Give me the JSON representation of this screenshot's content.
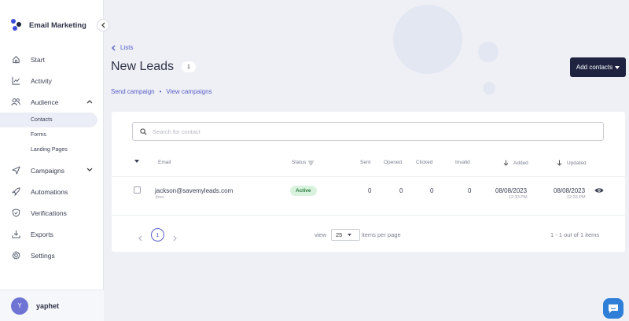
{
  "app": {
    "name": "Email Marketing"
  },
  "sidebar": {
    "items": [
      {
        "label": "Start",
        "icon": "home-icon"
      },
      {
        "label": "Activity",
        "icon": "chart-icon"
      },
      {
        "label": "Audience",
        "icon": "users-icon"
      },
      {
        "label": "Contacts"
      },
      {
        "label": "Forms"
      },
      {
        "label": "Landing Pages"
      },
      {
        "label": "Campaigns",
        "icon": "send-icon"
      },
      {
        "label": "Automations",
        "icon": "rocket-icon"
      },
      {
        "label": "Verifications",
        "icon": "shield-icon"
      },
      {
        "label": "Exports",
        "icon": "download-icon"
      },
      {
        "label": "Settings",
        "icon": "gear-icon"
      }
    ]
  },
  "user": {
    "initial": "Y",
    "name": "yaphet"
  },
  "breadcrumb": {
    "label": "Lists"
  },
  "page": {
    "title": "New Leads",
    "count": "1"
  },
  "toolbar": {
    "add_contacts": "Add contacts",
    "send_campaign": "Send campaign",
    "view_campaigns": "View campaigns"
  },
  "search": {
    "placeholder": "Search for contact"
  },
  "table": {
    "headers": {
      "email": "Email",
      "status": "Status",
      "sent": "Sent",
      "opened": "Opened",
      "clicked": "Clicked",
      "invalid": "Invalid",
      "added": "Added",
      "updated": "Updated"
    },
    "rows": [
      {
        "email": "jackson@savemyleads.com",
        "name": "jhon",
        "status": "Active",
        "sent": "0",
        "opened": "0",
        "clicked": "0",
        "invalid": "0",
        "added_date": "08/08/2023",
        "added_time": "12:33 PM",
        "updated_date": "08/08/2023",
        "updated_time": "12:33 PM"
      }
    ]
  },
  "pagination": {
    "current": "1",
    "view_label": "view",
    "per_page": "25",
    "per_page_label": "items per page",
    "summary": "1 - 1 out of 1 items"
  },
  "colors": {
    "accent": "#5a5fc7",
    "dark_button": "#1f2340",
    "status_active": "#d9f2de",
    "chat": "#2f7fd8"
  }
}
